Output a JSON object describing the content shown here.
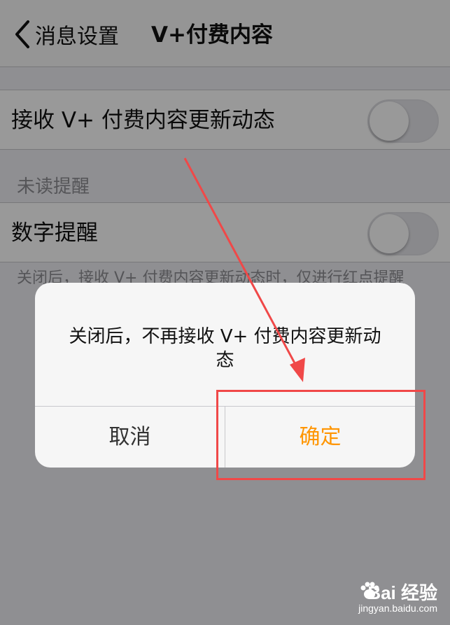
{
  "nav": {
    "back_label": "消息设置",
    "title": "V+付费内容"
  },
  "settings": {
    "receive_updates": {
      "label": "接收 V+ 付费内容更新动态",
      "enabled": false
    },
    "section_header": "未读提醒",
    "number_reminder": {
      "label": "数字提醒",
      "enabled": false
    },
    "footer_note": "关闭后，接收 V+ 付费内容更新动态时，仅进行红点提醒"
  },
  "alert": {
    "message": "关闭后，不再接收 V+ 付费内容更新动态",
    "cancel_label": "取消",
    "confirm_label": "确定"
  },
  "colors": {
    "accent": "#ff9500",
    "annotation": "#f04848"
  },
  "watermark": {
    "logo": "Bai  经验",
    "url": "jingyan.baidu.com"
  }
}
